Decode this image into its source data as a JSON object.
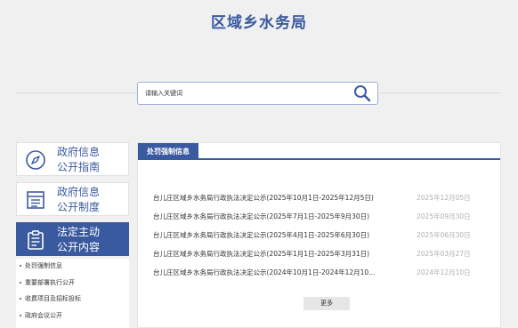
{
  "header": {
    "title": "区域乡水务局"
  },
  "search": {
    "placeholder": "请输入关键词",
    "value": ""
  },
  "sidebar": {
    "cards": [
      {
        "label_line1": "政府信息",
        "label_line2": "公开指南",
        "icon": "compass-icon",
        "active": false
      },
      {
        "label_line1": "政府信息",
        "label_line2": "公开制度",
        "icon": "document-list-icon",
        "active": false
      },
      {
        "label_line1": "法定主动",
        "label_line2": "公开内容",
        "icon": "clipboard-icon",
        "active": true
      }
    ],
    "sub_items": [
      {
        "label": "处罚强制信息"
      },
      {
        "label": "重要部署执行公开"
      },
      {
        "label": "收费项目及招标投标"
      },
      {
        "label": "政府会议公开"
      }
    ]
  },
  "main": {
    "tab_label": "处罚强制信息",
    "rows": [
      {
        "title": "台儿庄区域乡水务局行政执法决定公示(2025年10月1日-2025年12月5日)",
        "date": "2025年12月05日"
      },
      {
        "title": "台儿庄区域乡水务局行政执法决定公示(2025年7月1日-2025年9月30日)",
        "date": "2025年09月30日"
      },
      {
        "title": "台儿庄区域乡水务局行政执法决定公示(2025年4月1日-2025年6月30日)",
        "date": "2025年06月30日"
      },
      {
        "title": "台儿庄区域乡水务局行政执法决定公示(2025年1月1日-2025年3月31日)",
        "date": "2025年03月27日"
      },
      {
        "title": "台儿庄区域乡水务局行政执法决定公示(2024年10月1日-2024年12月10...",
        "date": "2024年12月10日"
      }
    ],
    "more_label": "更多"
  },
  "colors": {
    "accent": "#3a5aa0",
    "date": "#b0b0b0",
    "background": "#f0f0f0"
  }
}
